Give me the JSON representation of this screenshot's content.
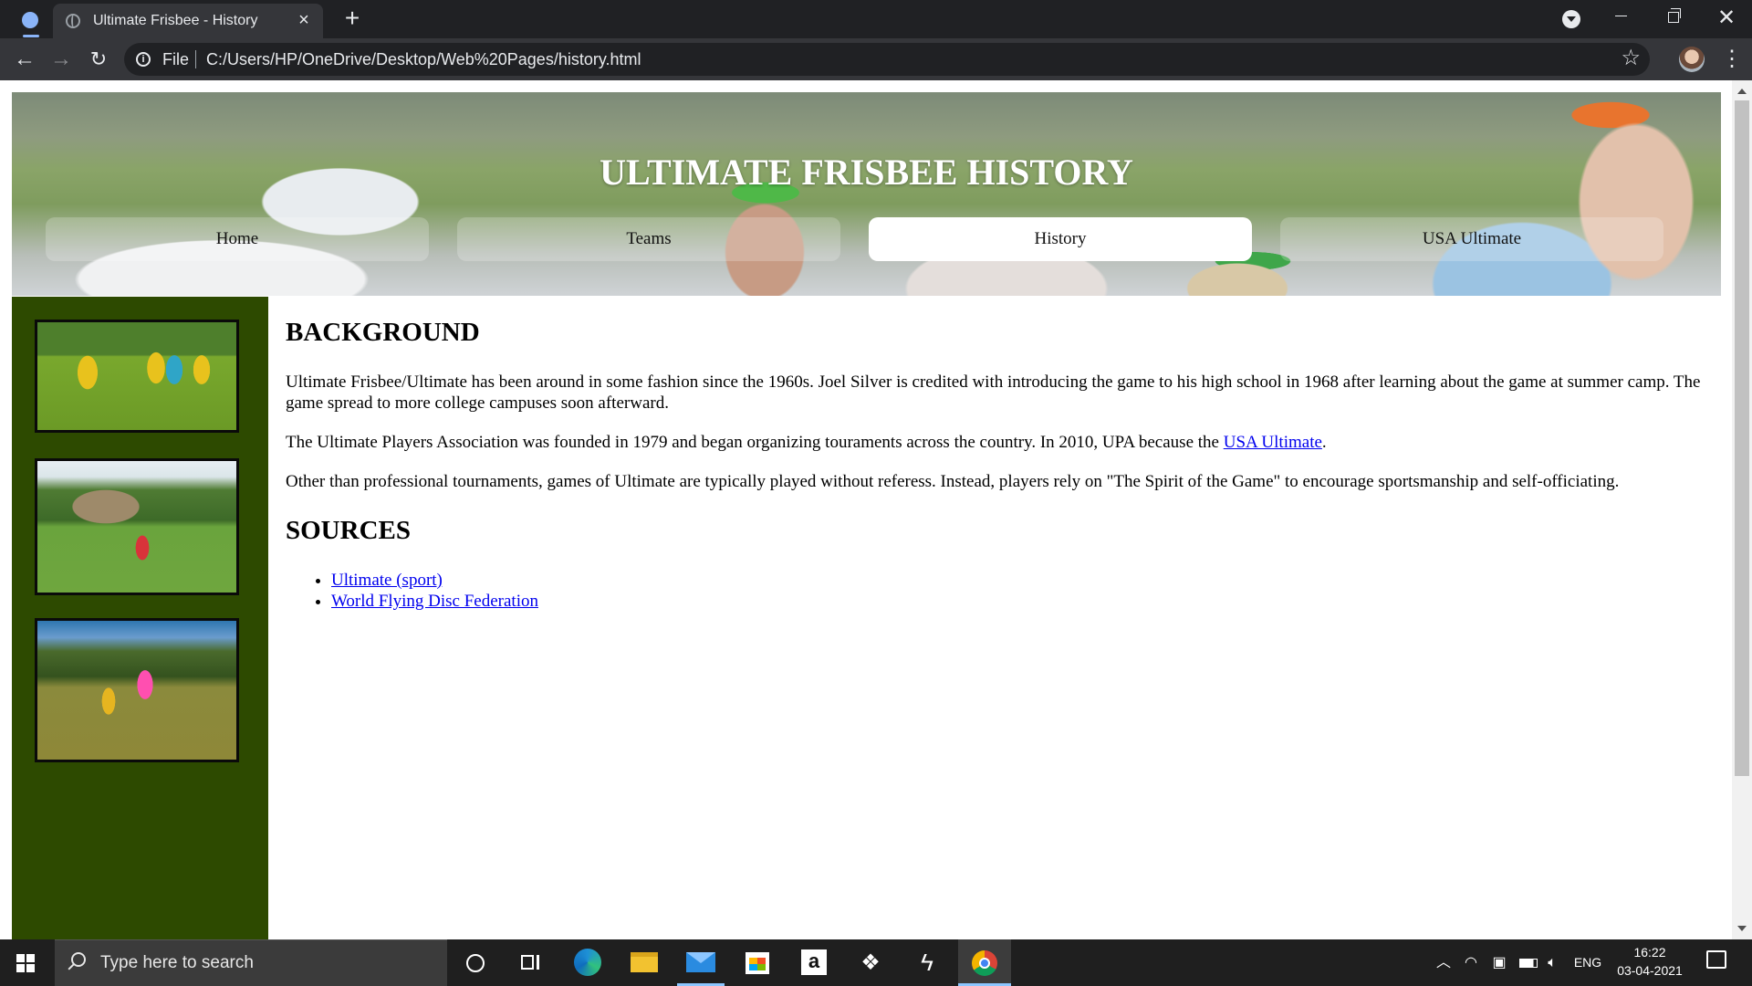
{
  "browser": {
    "tab_title": "Ultimate Frisbee - History",
    "tab_close": "×",
    "new_tab": "+",
    "scheme_label": "File",
    "url": "C:/Users/HP/OneDrive/Desktop/Web%20Pages/history.html",
    "icons": [
      "profile-icon",
      "globe-icon",
      "close-icon",
      "plus-icon",
      "tab-search-icon",
      "minimize-icon",
      "maximize-icon",
      "close-window-icon",
      "back-arrow-icon",
      "forward-arrow-icon",
      "reload-icon",
      "info-icon",
      "star-icon",
      "avatar",
      "more-vert-icon"
    ]
  },
  "page": {
    "title": "ULTIMATE FRISBEE HISTORY",
    "nav": [
      {
        "label": "Home"
      },
      {
        "label": "Teams"
      },
      {
        "label": "History"
      },
      {
        "label": "USA Ultimate"
      }
    ],
    "active_nav": "History",
    "background_heading": "BACKGROUND",
    "paragraphs": [
      "Ultimate Frisbee/Ultimate has been around in some fashion since the 1960s. Joel Silver is credited with introducing the game to his high school in 1968 after learning about the game at summer camp. The game spread to more college campuses soon afterward.",
      "The Ultimate Players Association was founded in 1979 and began organizing touraments across the country. In 2010, UPA because the",
      "Other than professional tournaments, games of Ultimate are typically played without referess. Instead, players rely on \"The Spirit of the Game\" to encourage sportsmanship and self-officiating."
    ],
    "inline_link": "USA Ultimate",
    "inline_link_suffix": ".",
    "sources_heading": "SOURCES",
    "sources": [
      {
        "label": "Ultimate (sport)"
      },
      {
        "label": "World Flying Disc Federation"
      }
    ],
    "colors": {
      "sidebar": "#2d4a00",
      "link": "#0000ee",
      "nav_active": "#ffffff"
    }
  },
  "taskbar": {
    "search_placeholder": "Type here to search",
    "amazon_glyph": "a",
    "language": "ENG",
    "time": "16:22",
    "date": "03-04-2021",
    "icons": [
      "windows-start-icon",
      "search-icon",
      "cortana-icon",
      "task-view-icon",
      "edge-icon",
      "file-explorer-icon",
      "mail-icon",
      "store-icon",
      "amazon-icon",
      "dropbox-icon",
      "app-icon",
      "chrome-icon",
      "chevron-up-icon",
      "wifi-icon",
      "network-icon",
      "battery-icon",
      "volume-icon",
      "notification-icon"
    ]
  }
}
